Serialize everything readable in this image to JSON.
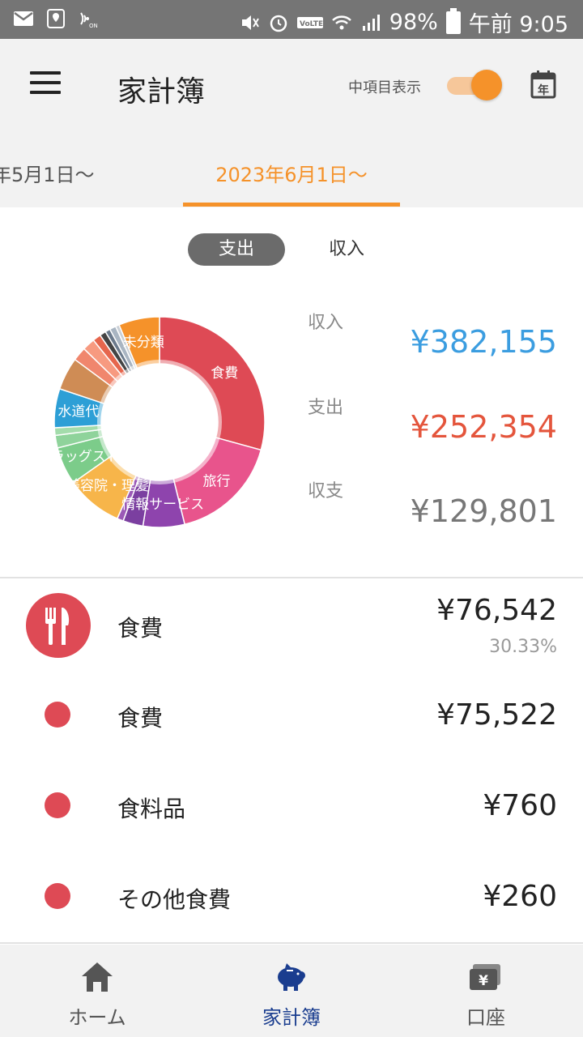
{
  "status_bar": {
    "battery": "98%",
    "time": "午前 9:05"
  },
  "app_bar": {
    "title": "家計簿",
    "toggle_label": "中項目表示",
    "toggle_on": true,
    "calendar_icon_text": "年"
  },
  "date_tabs": {
    "previous": "年5月1日～",
    "current": "2023年6月1日～"
  },
  "segment": {
    "active": "支出",
    "inactive": "収入"
  },
  "summary": {
    "income_label": "収入",
    "income_value": "¥382,155",
    "expense_label": "支出",
    "expense_value": "¥252,354",
    "balance_label": "収支",
    "balance_value": "¥129,801"
  },
  "chart_data": {
    "type": "pie",
    "slices": [
      {
        "label": "食費",
        "value": 30.33,
        "color": "#de4a55"
      },
      {
        "label": "旅行",
        "value": 17.5,
        "color": "#e8548c"
      },
      {
        "label": "情報サービス",
        "value": 6.6,
        "color": "#8e44ad"
      },
      {
        "label": "",
        "value": 3.2,
        "color": "#7b3fa0"
      },
      {
        "label": "",
        "value": 1.0,
        "color": "#9b59b6"
      },
      {
        "label": "美容院・理髪",
        "value": 9.0,
        "color": "#f7b54a"
      },
      {
        "label": "ドラッグストア",
        "value": 6.0,
        "color": "#7ccc8a"
      },
      {
        "label": "",
        "value": 2.0,
        "color": "#8fd39b"
      },
      {
        "label": "",
        "value": 1.2,
        "color": "#a3dcab"
      },
      {
        "label": "水道代",
        "value": 6.2,
        "color": "#2d9fd6"
      },
      {
        "label": "",
        "value": 5.2,
        "color": "#cf8c55"
      },
      {
        "label": "",
        "value": 2.2,
        "color": "#f0866d"
      },
      {
        "label": "",
        "value": 2.0,
        "color": "#f79a80"
      },
      {
        "label": "",
        "value": 1.3,
        "color": "#e6664d"
      },
      {
        "label": "",
        "value": 1.0,
        "color": "#444444"
      },
      {
        "label": "",
        "value": 0.8,
        "color": "#6b7a8c"
      },
      {
        "label": "",
        "value": 1.0,
        "color": "#a9b5c2"
      },
      {
        "label": "",
        "value": 0.6,
        "color": "#c9cfd6"
      },
      {
        "label": "未分類",
        "value": 6.5,
        "color": "#f5922a"
      }
    ]
  },
  "category": {
    "name": "食費",
    "amount": "¥76,542",
    "percent": "30.33%",
    "icon": "fork-knife-icon",
    "color": "#de4a55",
    "items": [
      {
        "name": "食費",
        "amount": "¥75,522"
      },
      {
        "name": "食料品",
        "amount": "¥760"
      },
      {
        "name": "その他食費",
        "amount": "¥260"
      }
    ]
  },
  "bottom_nav": {
    "home": "ホーム",
    "kakeibo": "家計簿",
    "account": "口座",
    "account_icon_text": "¥",
    "active_color": "#1a3d8f"
  }
}
